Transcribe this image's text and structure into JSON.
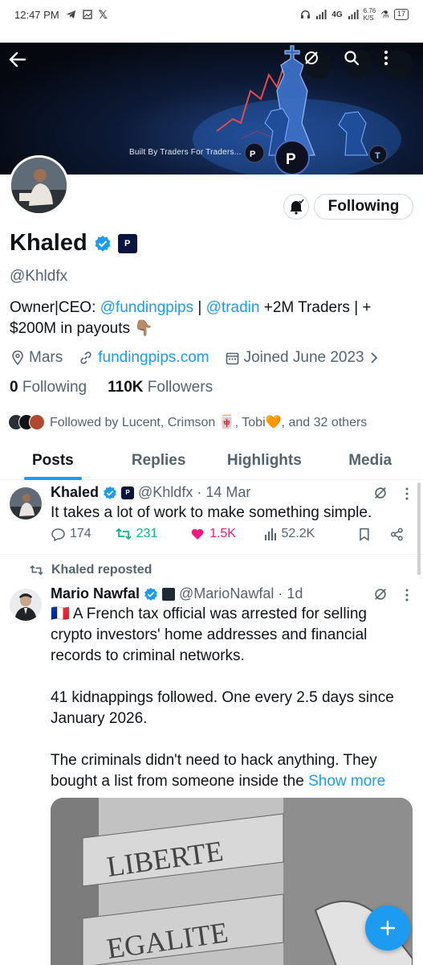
{
  "status_bar": {
    "time": "12:47 PM",
    "network": "4G",
    "speed": "6.76",
    "speed_unit": "K/S",
    "battery": "17"
  },
  "banner": {
    "text": "Built By Traders For Traders...",
    "colors": {
      "bg": "#05080f",
      "glow": "#2b6fd6"
    }
  },
  "profile": {
    "name": "Khaled",
    "affiliate_badge": "P",
    "handle": "@Khldfx",
    "follow_button": "Following",
    "bio": {
      "prefix": "Owner|CEO: ",
      "mention1": "@fundingpips",
      "sep": " | ",
      "mention2": "@tradin",
      "suffix": "  +2M Traders | + $200M in payouts 👇🏽"
    },
    "location": "Mars",
    "website": "fundingpips.com",
    "joined": "Joined June 2023",
    "following_count": "0",
    "following_label": "Following",
    "followers_count": "110K",
    "followers_label": "Followers",
    "followed_by": "Followed by Lucent, Crimson 🀄, Tobi🧡, and 32 others"
  },
  "tabs": [
    {
      "label": "Posts",
      "active": true
    },
    {
      "label": "Replies",
      "active": false
    },
    {
      "label": "Highlights",
      "active": false
    },
    {
      "label": "Media",
      "active": false
    }
  ],
  "posts": [
    {
      "author": "Khaled",
      "handle": "@Khldfx",
      "date": "· 14 Mar",
      "text": "It takes a lot of work to make something simple.",
      "replies": "174",
      "reposts": "231",
      "likes": "1.5K",
      "views": "52.2K",
      "repost_color": "#00ba7c",
      "like_color": "#f91880"
    },
    {
      "repost_label": "Khaled reposted",
      "author": "Mario Nawfal",
      "handle": "@MarioNawfal",
      "date": "· 1d",
      "text_1": "🇫🇷 A French tax official was arrested for selling crypto investors' home addresses and financial records to criminal networks.",
      "text_2": "41 kidnappings followed. One every 2.5 days since January 2026.",
      "text_3": "The criminals didn't need to hack anything. They bought a list from someone inside the ",
      "show_more": "Show more",
      "image_words": [
        "LIBERTE",
        "EGALITE"
      ]
    }
  ],
  "icons": {
    "back": "arrow-left-icon",
    "grok": "grok-icon",
    "search": "search-icon",
    "more": "more-vertical-icon",
    "compose": "plus-icon"
  }
}
